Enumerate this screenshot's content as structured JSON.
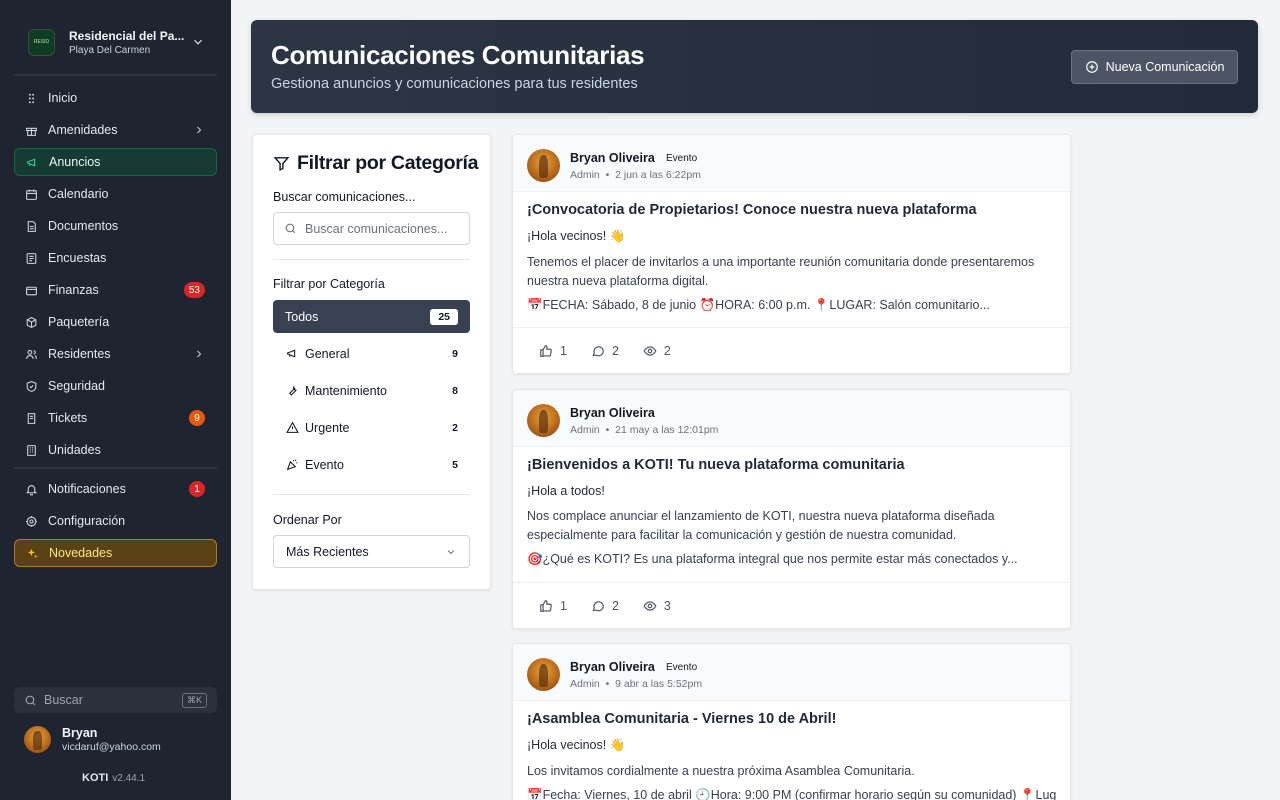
{
  "org": {
    "name": "Residencial del Pa...",
    "location": "Playa Del Carmen",
    "logo_text": "RESID"
  },
  "nav": {
    "main": [
      {
        "label": "Inicio",
        "icon": "grid-icon"
      },
      {
        "label": "Amenidades",
        "icon": "gift-icon",
        "chevron": true
      },
      {
        "label": "Anuncios",
        "icon": "megaphone-icon",
        "active": true
      },
      {
        "label": "Calendario",
        "icon": "calendar-icon"
      },
      {
        "label": "Documentos",
        "icon": "document-icon"
      },
      {
        "label": "Encuestas",
        "icon": "poll-icon"
      },
      {
        "label": "Finanzas",
        "icon": "wallet-icon",
        "badge": "53"
      },
      {
        "label": "Paquetería",
        "icon": "package-icon"
      },
      {
        "label": "Residentes",
        "icon": "users-icon",
        "chevron": true
      },
      {
        "label": "Seguridad",
        "icon": "shield-icon"
      },
      {
        "label": "Tickets",
        "icon": "ticket-icon",
        "badge": "9"
      },
      {
        "label": "Unidades",
        "icon": "building-icon"
      }
    ],
    "secondary": [
      {
        "label": "Notificaciones",
        "icon": "bell-icon",
        "badge": "1"
      },
      {
        "label": "Configuración",
        "icon": "gear-icon"
      },
      {
        "label": "Novedades",
        "icon": "sparkles-icon"
      }
    ]
  },
  "sidebar_search": {
    "placeholder": "Buscar",
    "shortcut": "⌘K"
  },
  "user": {
    "name": "Bryan",
    "email": "vicdaruf@yahoo.com"
  },
  "app": {
    "name": "KOTI",
    "version": "v2.44.1"
  },
  "header": {
    "title": "Comunicaciones Comunitarias",
    "subtitle": "Gestiona anuncios y comunicaciones para tus residentes",
    "new_button": "Nueva Comunicación"
  },
  "filter": {
    "title": "Filtrar por Categoría",
    "search_label": "Buscar comunicaciones...",
    "search_placeholder": "Buscar comunicaciones...",
    "category_label": "Filtrar por Categoría",
    "categories": [
      {
        "label": "Todos",
        "count": "25",
        "active": true
      },
      {
        "label": "General",
        "count": "9"
      },
      {
        "label": "Mantenimiento",
        "count": "8"
      },
      {
        "label": "Urgente",
        "count": "2"
      },
      {
        "label": "Evento",
        "count": "5"
      }
    ],
    "sort_label": "Ordenar Por",
    "sort_value": "Más Recientes"
  },
  "posts": [
    {
      "author": "Bryan Oliveira",
      "tag": "Evento",
      "role": "Admin",
      "date": "2 jun a las 6:22pm",
      "title": "¡Convocatoria de Propietarios! Conoce nuestra nueva plataforma",
      "greeting": "¡Hola vecinos! 👋",
      "text": "Tenemos el placer de invitarlos a una importante reunión comunitaria donde presentaremos nuestra nueva plataforma digital.",
      "detail": "📅FECHA: Sábado, 8 de junio ⏰HORA: 6:00 p.m. 📍LUGAR: Salón comunitario...",
      "likes": "1",
      "comments": "2",
      "views": "2"
    },
    {
      "author": "Bryan Oliveira",
      "tag": "",
      "role": "Admin",
      "date": "21 may a las 12:01pm",
      "title": "¡Bienvenidos a KOTI! Tu nueva plataforma comunitaria",
      "greeting": "¡Hola a todos!",
      "text": "Nos complace anunciar el lanzamiento de KOTI, nuestra nueva plataforma diseñada especialmente para facilitar la comunicación y gestión de nuestra comunidad.",
      "detail": "🎯¿Qué es KOTI? Es una plataforma integral que nos permite estar más conectados y...",
      "likes": "1",
      "comments": "2",
      "views": "3"
    },
    {
      "author": "Bryan Oliveira",
      "tag": "Evento",
      "role": "Admin",
      "date": "9 abr a las 5:52pm",
      "title": "¡Asamblea Comunitaria - Viernes 10 de Abril!",
      "greeting": "¡Hola vecinos! 👋",
      "text": "Los invitamos cordialmente a nuestra próxima Asamblea Comunitaria.",
      "detail": "📅Fecha: Viernes, 10 de abril 🕘Hora: 9:00 PM (confirmar horario según su comunidad) 📍Lugar:",
      "likes": "",
      "comments": "",
      "views": ""
    }
  ]
}
